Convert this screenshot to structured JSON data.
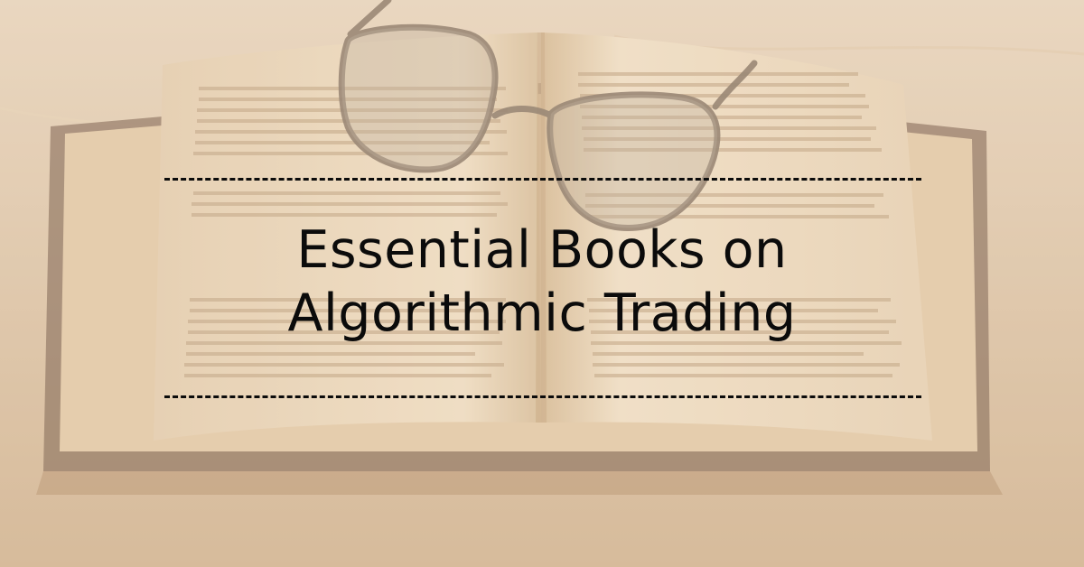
{
  "title": {
    "line1": "Essential Books on",
    "line2": "Algorithmic Trading"
  },
  "colors": {
    "background": "#d8bfa4",
    "text": "#0b0b0b",
    "divider": "#0b0b0b"
  },
  "icons": {
    "background_image": "open-book-with-glasses-icon"
  }
}
